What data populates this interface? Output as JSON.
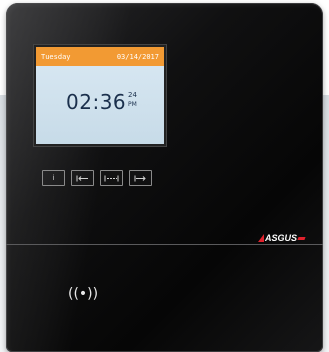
{
  "display": {
    "day": "Tuesday",
    "date": "03/14/2017",
    "time": "02:36",
    "seconds": "24",
    "ampm": "PM",
    "header_color": "#f29a33",
    "screen_color": "#cfe0ec"
  },
  "keys": [
    {
      "label": "i",
      "icon": "info-icon"
    },
    {
      "label": "",
      "icon": "clock-in-icon"
    },
    {
      "label": "",
      "icon": "break-icon"
    },
    {
      "label": "",
      "icon": "clock-out-icon"
    }
  ],
  "brand": {
    "name": "ASGUS",
    "accent": "#e0212c"
  },
  "rfid": {
    "symbol": "((•))",
    "icon": "rfid-reader-icon"
  }
}
